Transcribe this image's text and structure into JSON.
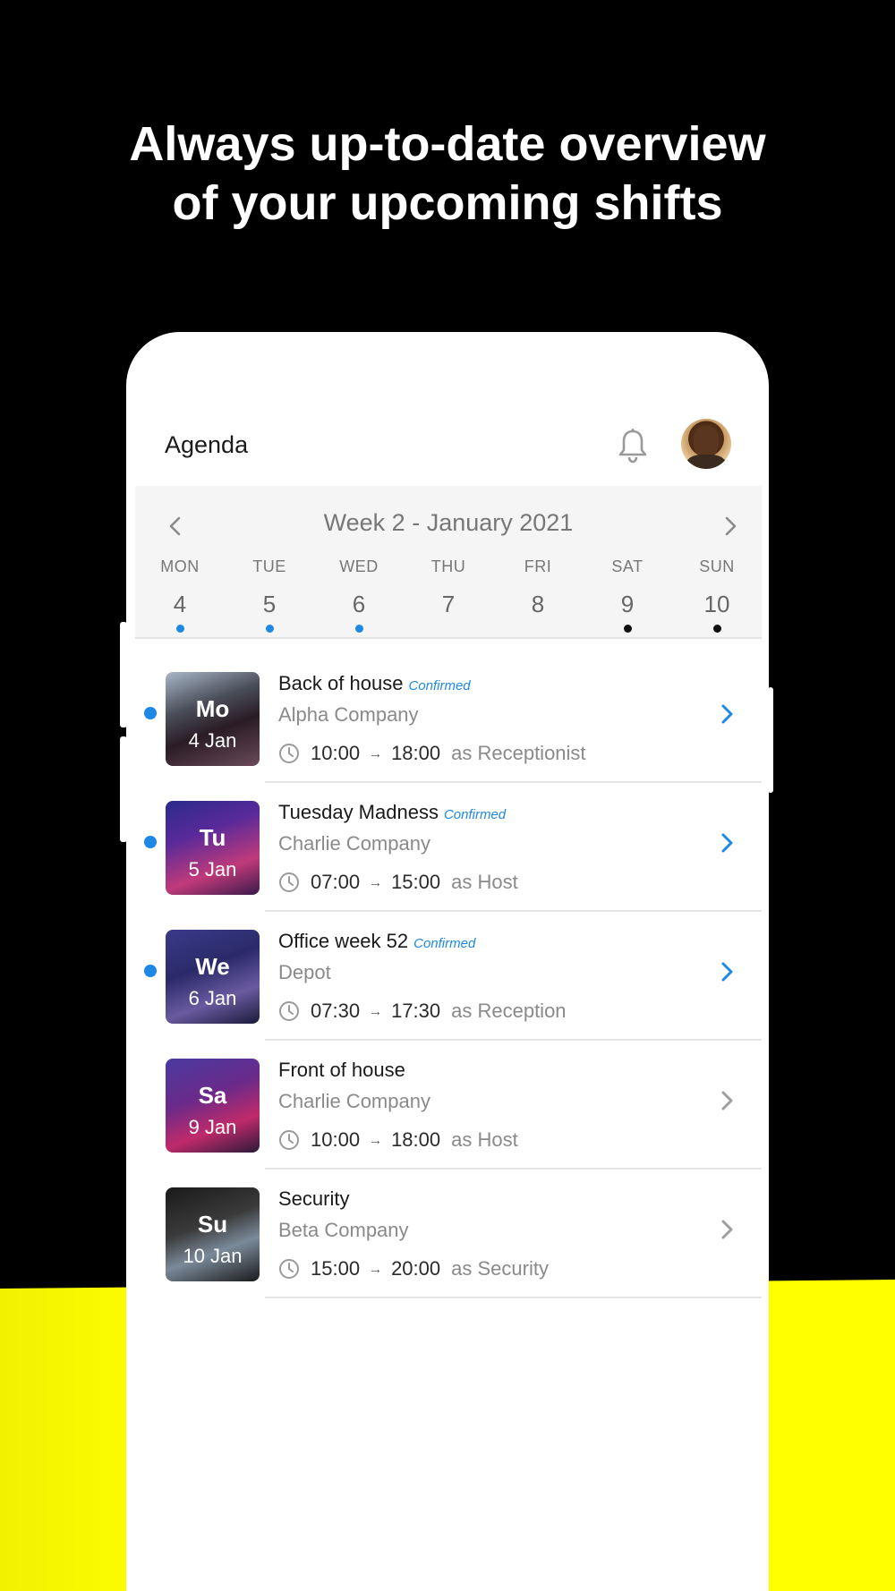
{
  "colors": {
    "background": "#000000",
    "accent_yellow": "#ffff00",
    "confirmed_blue": "#1e88e5",
    "dot_black": "#111111",
    "chevron_grey": "#9e9e9e"
  },
  "headline": {
    "line1": "Always up-to-date overview",
    "line2": "of your upcoming shifts"
  },
  "app": {
    "title": "Agenda",
    "bell_icon": "bell-icon",
    "avatar_icon": "user-avatar"
  },
  "calendar": {
    "title": "Week 2 - January 2021",
    "prev_icon": "chevron-left-icon",
    "next_icon": "chevron-right-icon",
    "days": [
      {
        "name": "MON",
        "number": "4",
        "dot": "blue"
      },
      {
        "name": "TUE",
        "number": "5",
        "dot": "blue"
      },
      {
        "name": "WED",
        "number": "6",
        "dot": "blue"
      },
      {
        "name": "THU",
        "number": "7",
        "dot": "none"
      },
      {
        "name": "FRI",
        "number": "8",
        "dot": "none"
      },
      {
        "name": "SAT",
        "number": "9",
        "dot": "black"
      },
      {
        "name": "SUN",
        "number": "10",
        "dot": "black"
      }
    ]
  },
  "shifts": [
    {
      "abbr": "Mo",
      "date": "4 Jan",
      "title": "Back of house",
      "status": "Confirmed",
      "company": "Alpha Company",
      "start": "10:00",
      "end": "18:00",
      "role": "as Receptionist",
      "active": true
    },
    {
      "abbr": "Tu",
      "date": "5 Jan",
      "title": "Tuesday Madness",
      "status": "Confirmed",
      "company": "Charlie Company",
      "start": "07:00",
      "end": "15:00",
      "role": "as Host",
      "active": true
    },
    {
      "abbr": "We",
      "date": "6 Jan",
      "title": "Office week 52",
      "status": "Confirmed",
      "company": "Depot",
      "start": "07:30",
      "end": "17:30",
      "role": "as Reception",
      "active": true
    },
    {
      "abbr": "Sa",
      "date": "9 Jan",
      "title": "Front of house",
      "status": "",
      "company": "Charlie Company",
      "start": "10:00",
      "end": "18:00",
      "role": "as Host",
      "active": false
    },
    {
      "abbr": "Su",
      "date": "10 Jan",
      "title": "Security",
      "status": "",
      "company": "Beta Company",
      "start": "15:00",
      "end": "20:00",
      "role": "as Security",
      "active": false
    }
  ],
  "arrow_glyph": "→"
}
